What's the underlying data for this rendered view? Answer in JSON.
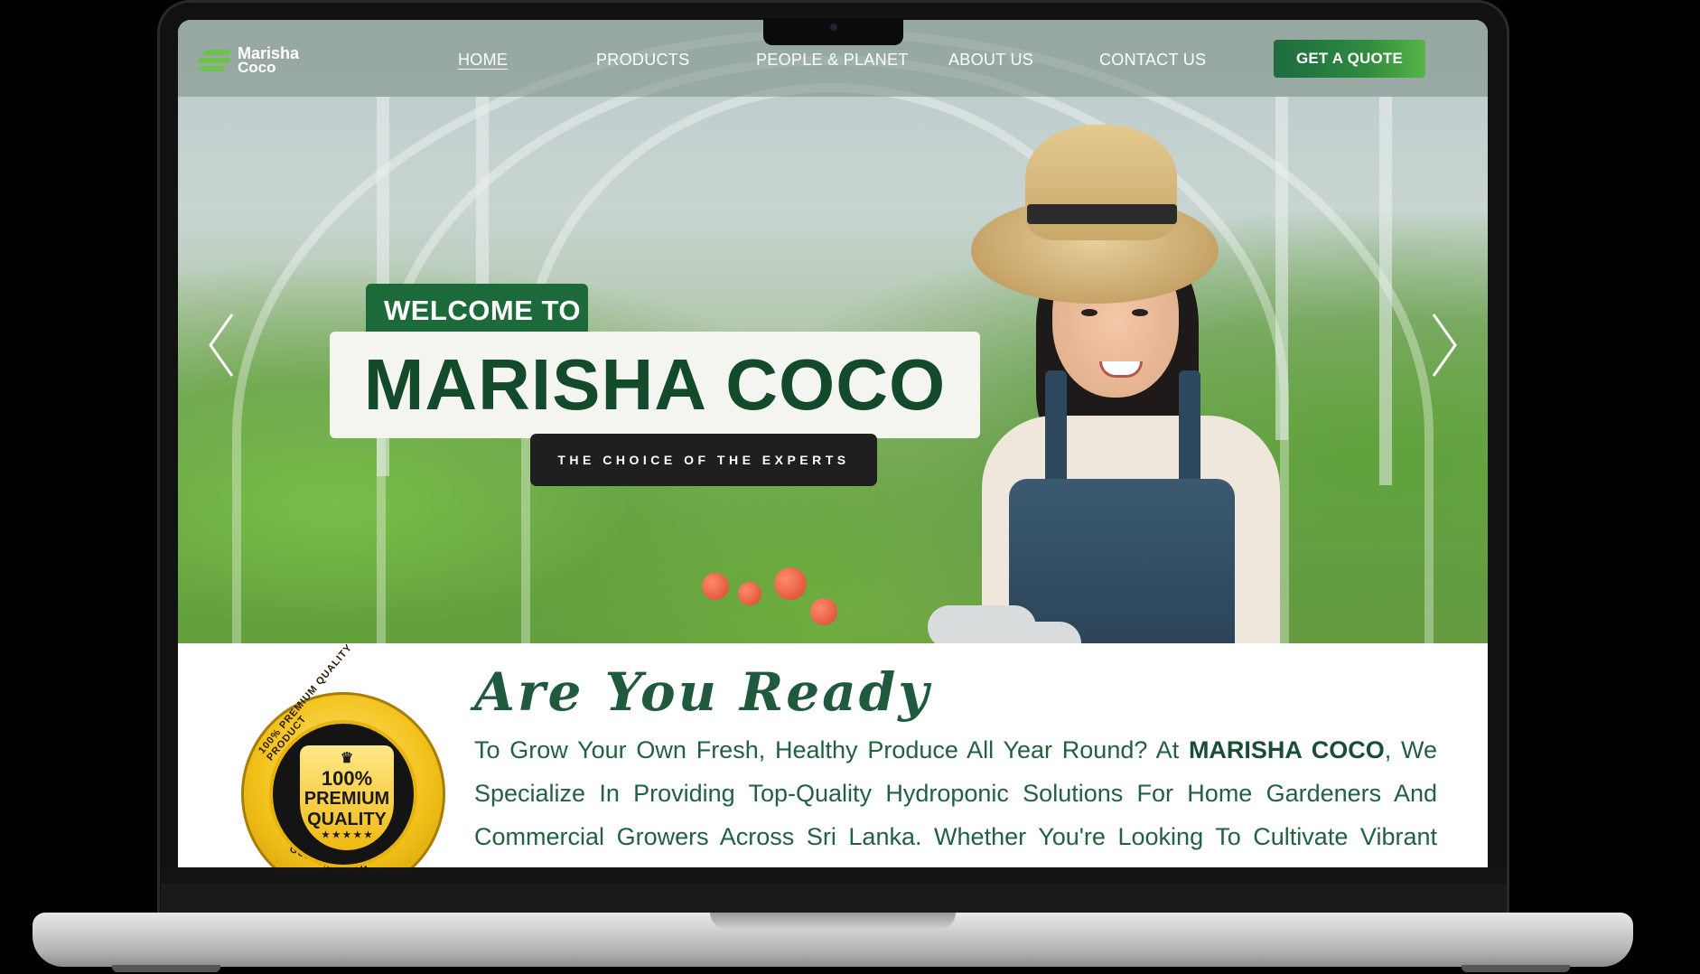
{
  "brand": {
    "name_line1": "Marisha",
    "name_line2": "Coco"
  },
  "nav": {
    "items": [
      {
        "label": "HOME",
        "active": true
      },
      {
        "label": "PRODUCTS",
        "active": false
      },
      {
        "label": "PEOPLE & PLANET",
        "active": false
      },
      {
        "label": "ABOUT US",
        "active": false
      },
      {
        "label": "CONTACT US",
        "active": false
      }
    ],
    "cta_label": "GET A QUOTE"
  },
  "hero": {
    "welcome": "WELCOME TO",
    "title": "MARISHA COCO",
    "tagline": "THE CHOICE OF THE EXPERTS",
    "prev_icon": "chevron-left-icon",
    "next_icon": "chevron-right-icon"
  },
  "intro": {
    "heading": "Are You Ready",
    "para_before": "To Grow Your Own Fresh, Healthy Produce All Year Round? At ",
    "para_brand": "MARISHA COCO",
    "para_after": ", We Specialize In Providing Top-Quality Hydroponic Solutions For Home Gardeners And Commercial Growers Across Sri Lanka. Whether You're Looking To Cultivate Vibrant Vegetables, Aromatic Herbs, Or Nutritious Leafy Greens, We Have Everything You"
  },
  "badge": {
    "percent": "100%",
    "line1": "PREMIUM",
    "line2": "QUALITY",
    "ring_top": "100% PREMIUM QUALITY PRODUCT",
    "ring_bottom": "SATISFACTION GUARANTEED",
    "stars": "★ ★ ★ ★ ★"
  },
  "colors": {
    "brand_green": "#1c6a3a",
    "title_green": "#124a2a",
    "text_green": "#226042",
    "cta_gradient_start": "#1d6b3f",
    "cta_gradient_end": "#55b546",
    "badge_gold": "#f2c21a"
  }
}
